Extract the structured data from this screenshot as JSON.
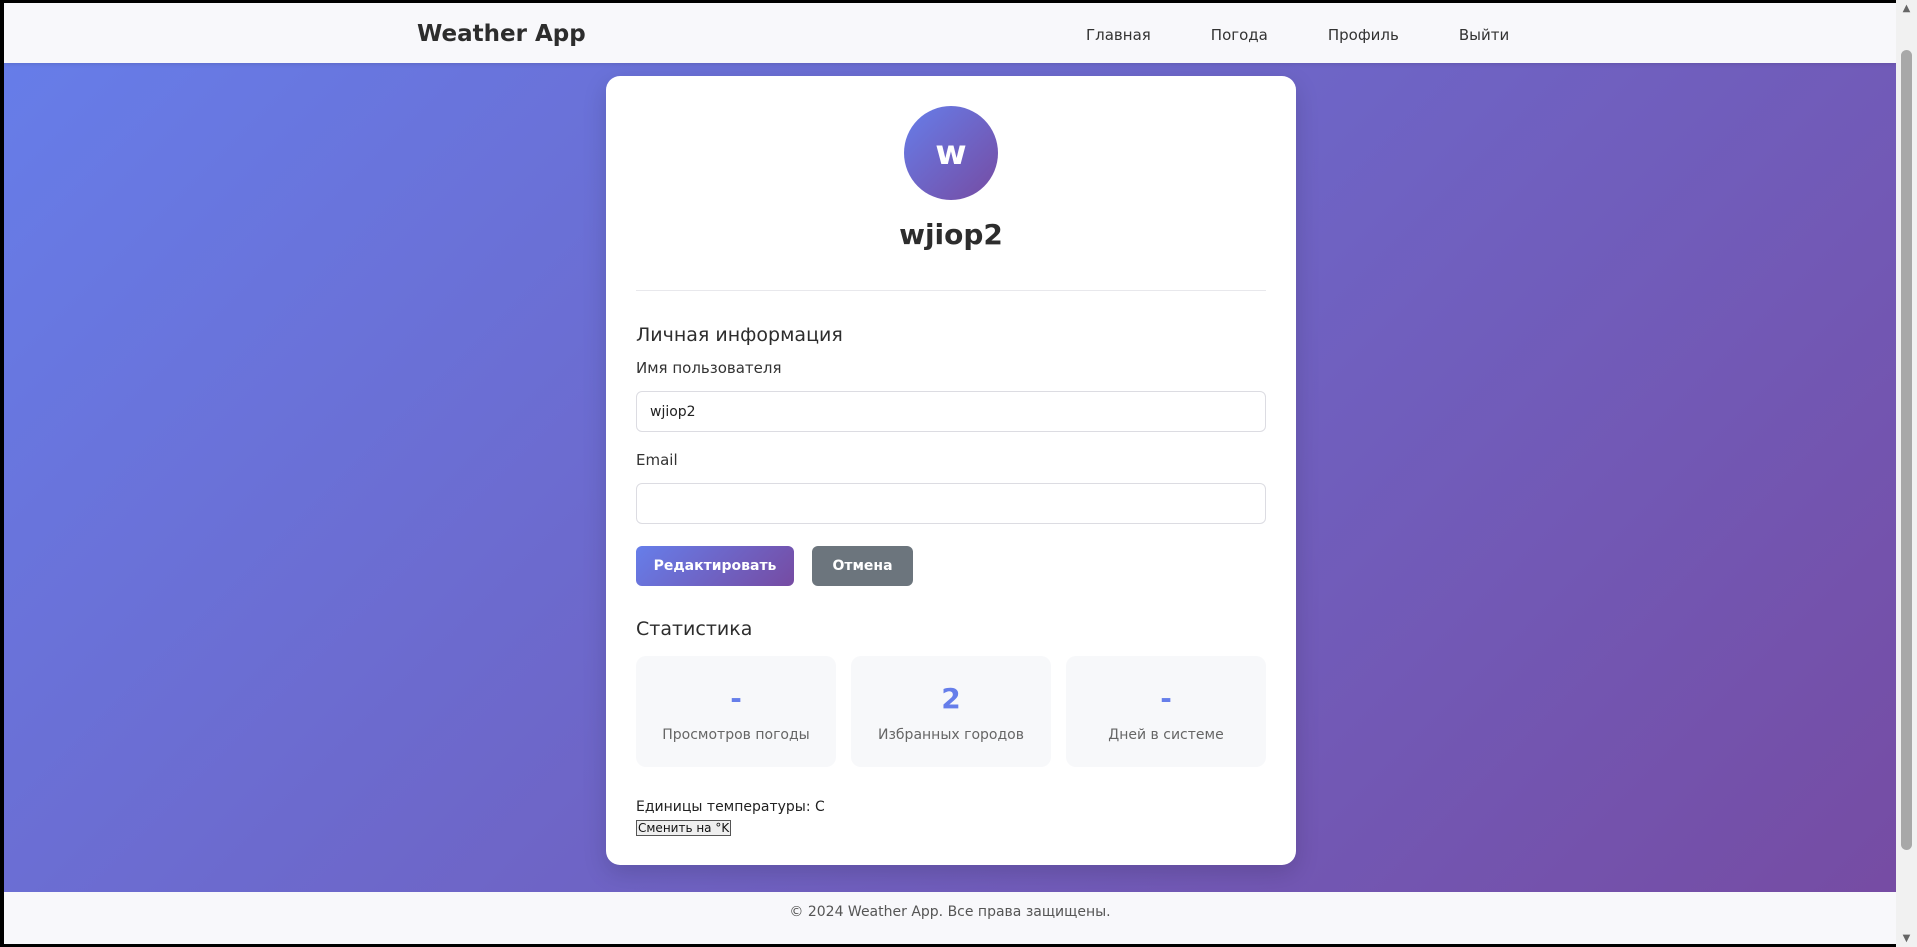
{
  "navbar": {
    "brand": "Weather App",
    "links": [
      "Главная",
      "Погода",
      "Профиль",
      "Выйти"
    ]
  },
  "profile": {
    "avatar_letter": "w",
    "username": "wjiop2"
  },
  "personal_info": {
    "title": "Личная информация",
    "username_label": "Имя пользователя",
    "username_value": "wjiop2",
    "email_label": "Email",
    "email_value": ""
  },
  "buttons": {
    "edit": "Редактировать",
    "cancel": "Отмена"
  },
  "stats": {
    "title": "Статистика",
    "items": [
      {
        "value": "-",
        "label": "Просмотров погоды"
      },
      {
        "value": "2",
        "label": "Избранных городов"
      },
      {
        "value": "-",
        "label": "Дней в системе"
      }
    ]
  },
  "units": {
    "text": "Единицы температуры: C",
    "toggle_label": "Сменить на °K"
  },
  "footer": {
    "text": "© 2024 Weather App. Все права защищены."
  },
  "colors": {
    "gradient_start": "#667eea",
    "gradient_end": "#764ba2",
    "cancel": "#6c757d"
  }
}
